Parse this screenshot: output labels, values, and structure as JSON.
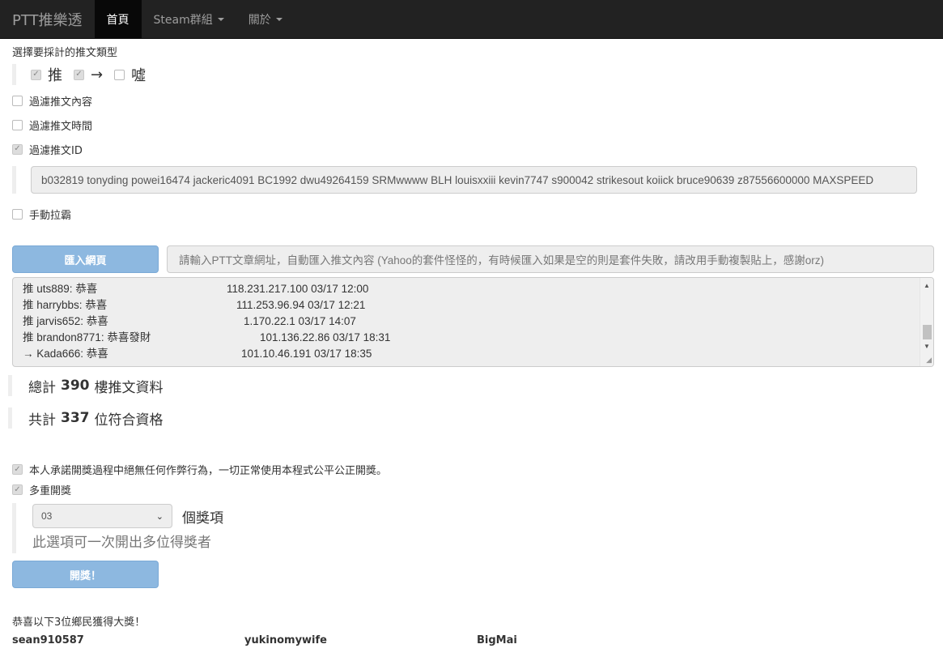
{
  "nav": {
    "brand": "PTT推樂透",
    "items": [
      {
        "label": "首頁",
        "active": true,
        "dropdown": false
      },
      {
        "label": "Steam群組",
        "active": false,
        "dropdown": true
      },
      {
        "label": "關於",
        "active": false,
        "dropdown": true
      }
    ]
  },
  "push_types": {
    "label": "選擇要採計的推文類型",
    "options": [
      {
        "label": "推",
        "checked": true
      },
      {
        "label": "→",
        "checked": true
      },
      {
        "label": "噓",
        "checked": false
      }
    ]
  },
  "filters": {
    "content": {
      "label": "過濾推文內容",
      "checked": false
    },
    "time": {
      "label": "過濾推文時間",
      "checked": false
    },
    "id": {
      "label": "過濾推文ID",
      "checked": true,
      "value": "b032819 tonyding powei16474 jackeric4091 BC1992 dwu49264159 SRMwwww BLH louisxxiii kevin7747 s900042 strikesout koiick bruce90639 z87556600000 MAXSPEED"
    },
    "manual": {
      "label": "手動拉霸",
      "checked": false
    }
  },
  "import": {
    "button_label": "匯入網頁",
    "placeholder": "請輸入PTT文章網址，自動匯入推文內容 (Yahoo的套件怪怪的，有時候匯入如果是空的則是套件失敗，請改用手動複製貼上，感謝orz)"
  },
  "comments": [
    {
      "text": "推 uts889: 恭喜",
      "meta": "118.231.217.100 03/17 12:00",
      "offset": 252
    },
    {
      "text": "推 harrybbs: 恭喜",
      "meta": "111.253.96.94 03/17 12:21",
      "offset": 264
    },
    {
      "text": "推 jarvis652: 恭喜",
      "meta": "1.170.22.1 03/17 14:07",
      "offset": 273
    },
    {
      "text": "推 brandon8771: 恭喜發財",
      "meta": "101.136.22.86 03/17 18:31",
      "offset": 293
    },
    {
      "text": "→ Kada666: 恭喜",
      "meta": "101.10.46.191 03/17 18:35",
      "offset": 270
    }
  ],
  "stats": {
    "total_prefix": "總計",
    "total_count": "390",
    "total_suffix": "樓推文資料",
    "eligible_prefix": "共計",
    "eligible_count": "337",
    "eligible_suffix": "位符合資格"
  },
  "pledge": {
    "label": "本人承諾開獎過程中絕無任何作弊行為，一切正常使用本程式公平公正開獎。",
    "checked": true
  },
  "multi": {
    "label": "多重開獎",
    "checked": true,
    "selected": "03",
    "unit": "個獎項",
    "help": "此選項可一次開出多位得獎者"
  },
  "draw_button": "開獎！",
  "result": {
    "congrats": "恭喜以下3位鄉民獲得大獎！",
    "winners": [
      "sean910587",
      "yukinomywife",
      "BigMai"
    ]
  }
}
